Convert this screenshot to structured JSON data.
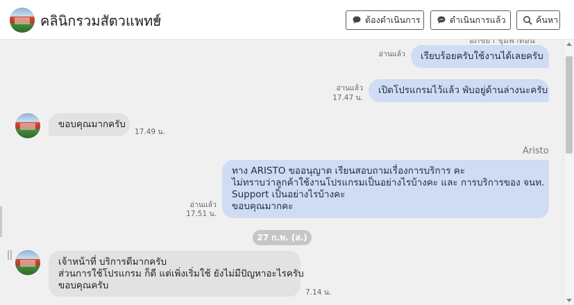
{
  "header": {
    "title": "คลินิกรวมสัตวแพทย์",
    "buttons": {
      "pending": "ต้องดำเนินการ",
      "done": "ดำเนินการแล้ว",
      "search": "ค้นหา"
    }
  },
  "messages": {
    "clipped_top": "อภิชยา ชุมพาทอน",
    "m1": {
      "text": "เรียบร้อยครับใช้งานได้เลยครับ",
      "read": "อ่านแล้ว"
    },
    "m2": {
      "text": "เปิดโปรแกรมไว้แล้ว พับอยู่ด้านล่างนะครับ",
      "read": "อ่านแล้ว",
      "time": "17.47 น."
    },
    "m3": {
      "text": "ขอบคุณมากครับ",
      "time": "17.49 น."
    },
    "m4": {
      "sender": "Aristo",
      "lines": [
        "ทาง ARISTO ขออนุญาต เรียนสอบถามเรื่องการบริการ คะ",
        "ไม่ทราบว่าลูกค้าใช้งานโปรแกรมเป็นอย่างไรบ้างคะ และ การบริการของ จนท.",
        "Support เป็นอย่างไรบ้างคะ",
        "ขอบคุณมากคะ"
      ],
      "read": "อ่านแล้ว",
      "time": "17.51 น."
    },
    "date_divider": "27 ก.พ. (ส.)",
    "m5": {
      "lines": [
        "เจ้าหน้าที่ บริการดีมากครับ",
        "ส่วนการใช้โปรแกรม ก็ดี แต่เพิ่งเริ่มใช้ ยังไม่มีปัญหาอะไรครับ",
        "ขอบคุณครับ"
      ],
      "time": "7.14 น."
    }
  },
  "colors": {
    "outgoing_bubble": "#cfdcf3",
    "incoming_bubble": "#e2e2e2",
    "chat_background": "#f0f0f0",
    "date_pill": "#c6c6c6"
  },
  "icons": {
    "header_avatar": "clinic-avatar",
    "speaker": "speaker-icon",
    "pending_button": "speech-bubble-icon",
    "done_button": "chat-bubble-icon",
    "search_button": "search-icon"
  }
}
